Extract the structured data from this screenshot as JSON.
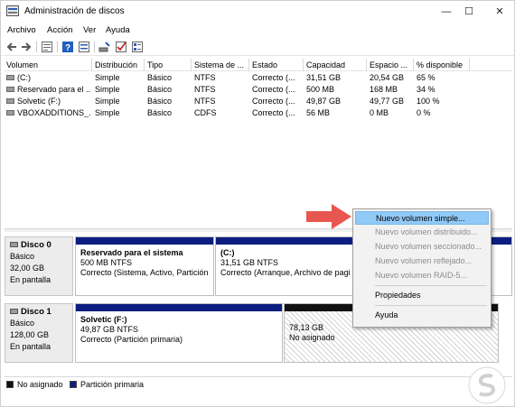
{
  "window": {
    "title": "Administración de discos",
    "controls": {
      "minimize": "—",
      "maximize": "☐",
      "close": "✕"
    }
  },
  "menu": [
    "Archivo",
    "Acción",
    "Ver",
    "Ayuda"
  ],
  "toolbar": [
    "back-icon",
    "forward-icon",
    "properties-icon",
    "help-icon",
    "refresh-icon",
    "check-icon",
    "view-icon"
  ],
  "volumes": {
    "columns": [
      "Volumen",
      "Distribución",
      "Tipo",
      "Sistema de ...",
      "Estado",
      "Capacidad",
      "Espacio ...",
      "% disponible"
    ],
    "rows": [
      [
        "(C:)",
        "Simple",
        "Básico",
        "NTFS",
        "Correcto (...",
        "31,51 GB",
        "20,54 GB",
        "65 %"
      ],
      [
        "Reservado para el ...",
        "Simple",
        "Básico",
        "NTFS",
        "Correcto (...",
        "500 MB",
        "168 MB",
        "34 %"
      ],
      [
        "Solvetic (F:)",
        "Simple",
        "Básico",
        "NTFS",
        "Correcto (...",
        "49,87 GB",
        "49,77 GB",
        "100 %"
      ],
      [
        "VBOXADDITIONS_...",
        "Simple",
        "Básico",
        "CDFS",
        "Correcto (...",
        "56 MB",
        "0 MB",
        "0 %"
      ]
    ]
  },
  "disks": [
    {
      "name": "Disco 0",
      "type": "Básico",
      "size": "32,00 GB",
      "status": "En pantalla",
      "partitions": [
        {
          "name": "Reservado para el sistema",
          "size": "500 MB NTFS",
          "status": "Correcto (Sistema, Activo, Partición"
        },
        {
          "name": "(C:)",
          "size": "31,51 GB NTFS",
          "status": "Correcto (Arranque, Archivo de pagi"
        }
      ]
    },
    {
      "name": "Disco 1",
      "type": "Básico",
      "size": "128,00 GB",
      "status": "En pantalla",
      "partitions": [
        {
          "name": "Solvetic  (F:)",
          "size": "49,87 GB NTFS",
          "status": "Correcto (Partición primaria)"
        },
        {
          "name": "",
          "size": "78,13 GB",
          "status": "No asignado"
        }
      ]
    }
  ],
  "legend": [
    {
      "label": "No asignado",
      "color": "#111111"
    },
    {
      "label": "Partición primaria",
      "color": "#0c1e80"
    }
  ],
  "context_menu": {
    "items": [
      {
        "label": "Nuevo volumen simple...",
        "state": "highlighted"
      },
      {
        "label": "Nuevo volumen distribuido...",
        "state": "disabled"
      },
      {
        "label": "Nuevo volumen seccionado...",
        "state": "disabled"
      },
      {
        "label": "Nuevo volumen reflejado...",
        "state": "disabled"
      },
      {
        "label": "Nuevo volumen RAID-5...",
        "state": "disabled"
      },
      {
        "label": "Propiedades",
        "state": "enabled"
      },
      {
        "label": "Ayuda",
        "state": "enabled"
      }
    ]
  },
  "colors": {
    "primary_partition": "#0c1e80",
    "unallocated": "#111111",
    "highlight": "#91c9f7",
    "arrow": "#e8574f"
  }
}
